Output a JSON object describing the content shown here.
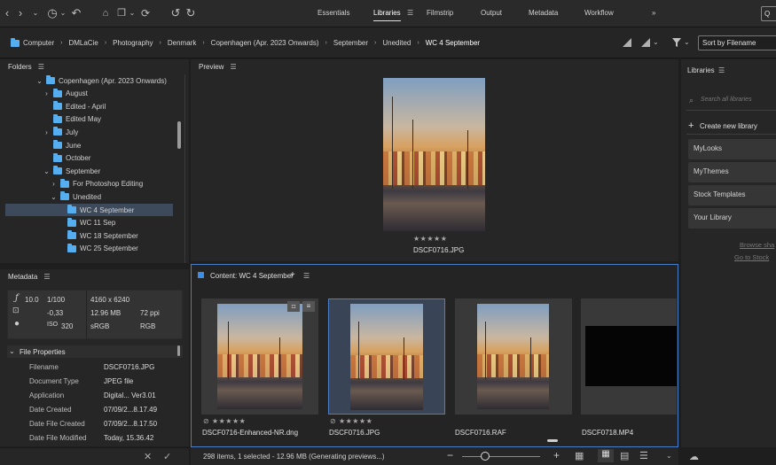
{
  "workspaces": [
    "Essentials",
    "Libraries",
    "Filmstrip",
    "Output",
    "Metadata",
    "Workflow"
  ],
  "active_workspace": "Libraries",
  "workspace_more": "»",
  "search_box": "Q",
  "breadcrumb": [
    "Computer",
    "DMLaCie",
    "Photography",
    "Denmark",
    "Copenhagen (Apr. 2023 Onwards)",
    "September",
    "Unedited",
    "WC 4 September"
  ],
  "sort_label": "Sort by Filename",
  "folders_panel": {
    "title": "Folders",
    "items": [
      {
        "label": "Copenhagen (Apr. 2023 Onwards)",
        "level": 0,
        "chevron": "down"
      },
      {
        "label": "August",
        "level": 1,
        "chevron": "right"
      },
      {
        "label": "Edited - April",
        "level": 1,
        "chevron": ""
      },
      {
        "label": "Edited May",
        "level": 1,
        "chevron": ""
      },
      {
        "label": "July",
        "level": 1,
        "chevron": "right"
      },
      {
        "label": "June",
        "level": 1,
        "chevron": ""
      },
      {
        "label": "October",
        "level": 1,
        "chevron": ""
      },
      {
        "label": "September",
        "level": 1,
        "chevron": "down"
      },
      {
        "label": "For Photoshop Editing",
        "level": 2,
        "chevron": "right"
      },
      {
        "label": "Unedited",
        "level": 2,
        "chevron": "down"
      },
      {
        "label": "WC 4 September",
        "level": 3,
        "chevron": "",
        "selected": true
      },
      {
        "label": "WC 11 Sep",
        "level": 3,
        "chevron": ""
      },
      {
        "label": "WC 18 September",
        "level": 3,
        "chevron": ""
      },
      {
        "label": "WC 25 September",
        "level": 3,
        "chevron": ""
      }
    ]
  },
  "preview_panel": {
    "title": "Preview",
    "filename": "DSCF0716.JPG",
    "stars": "★★★★★"
  },
  "metadata_panel": {
    "title": "Metadata",
    "aperture": "10.0",
    "shutter": "1/100",
    "exposure": "-0,33",
    "iso_label": "ISO",
    "iso": "320",
    "dimensions": "4160 x 6240",
    "filesize": "12.96 MB",
    "ppi": "72 ppi",
    "colorspace": "sRGB",
    "colormode": "RGB",
    "section_title": "File Properties",
    "properties": [
      {
        "key": "Filename",
        "value": "DSCF0716.JPG"
      },
      {
        "key": "Document Type",
        "value": "JPEG file"
      },
      {
        "key": "Application",
        "value": "Digital... Ver3.01"
      },
      {
        "key": "Date Created",
        "value": "07/09/2...8.17.49"
      },
      {
        "key": "Date File Created",
        "value": "07/09/2...8.17.50"
      },
      {
        "key": "Date File Modified",
        "value": "Today, 15.36.42"
      }
    ]
  },
  "content_panel": {
    "title": "Content: WC 4 September",
    "add": "+",
    "items": [
      {
        "filename": "DSCF0716-Enhanced-NR.dng",
        "stars": "★★★★★",
        "reject": "⊘",
        "selected": false
      },
      {
        "filename": "DSCF0716.JPG",
        "stars": "★★★★★",
        "reject": "⊘",
        "selected": true
      },
      {
        "filename": "DSCF0716.RAF",
        "stars": "",
        "reject": "",
        "selected": false
      },
      {
        "filename": "DSCF0718.MP4",
        "stars": "",
        "reject": "",
        "selected": false
      }
    ],
    "status": "298 items, 1 selected - 12.96 MB (Generating previews...)"
  },
  "libraries_panel": {
    "title": "Libraries",
    "search_placeholder": "Search all libraries",
    "create_label": "Create new library",
    "items": [
      "MyLooks",
      "MyThemes",
      "Stock Templates",
      "Your Library"
    ],
    "link_browse": "Browse sha",
    "link_stock": "Go to Stock"
  },
  "colors": {
    "accent": "#55aef0",
    "selection": "#4a7fc8",
    "background": "#1e1e1e"
  }
}
